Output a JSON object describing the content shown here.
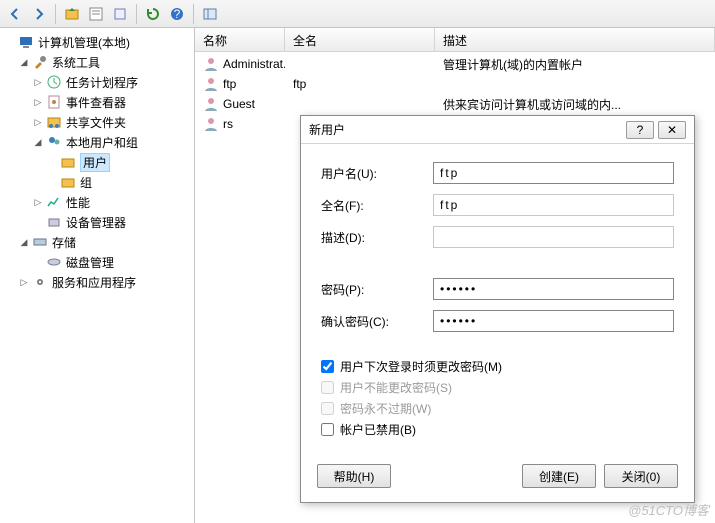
{
  "toolbar": {
    "buttons": [
      "back",
      "forward",
      "up",
      "show-hide",
      "export",
      "refresh",
      "help",
      "panel"
    ]
  },
  "tree": {
    "root": {
      "label": "计算机管理(本地)"
    },
    "sys_tools": {
      "label": "系统工具"
    },
    "task_sched": {
      "label": "任务计划程序"
    },
    "event_viewer": {
      "label": "事件查看器"
    },
    "shared_folders": {
      "label": "共享文件夹"
    },
    "local_users": {
      "label": "本地用户和组"
    },
    "users": {
      "label": "用户"
    },
    "groups": {
      "label": "组"
    },
    "perf": {
      "label": "性能"
    },
    "dev_mgr": {
      "label": "设备管理器"
    },
    "storage": {
      "label": "存储"
    },
    "disk_mgmt": {
      "label": "磁盘管理"
    },
    "services": {
      "label": "服务和应用程序"
    }
  },
  "columns": {
    "name": "名称",
    "fullname": "全名",
    "desc": "描述"
  },
  "col_widths": {
    "name": 90,
    "fullname": 150,
    "desc": 250
  },
  "rows": [
    {
      "name": "Administrat...",
      "fullname": "",
      "desc": "管理计算机(域)的内置帐户"
    },
    {
      "name": "ftp",
      "fullname": "ftp",
      "desc": ""
    },
    {
      "name": "Guest",
      "fullname": "",
      "desc": "供来宾访问计算机或访问域的内..."
    },
    {
      "name": "rs",
      "fullname": "",
      "desc": ""
    }
  ],
  "dialog": {
    "title": "新用户",
    "help_label": "?",
    "close_label": "✕",
    "fields": {
      "username_label": "用户名(U):",
      "username_value": "ftp",
      "fullname_label": "全名(F):",
      "fullname_value": "ftp",
      "desc_label": "描述(D):",
      "desc_value": "",
      "pwd_label": "密码(P):",
      "pwd2_label": "确认密码(C):"
    },
    "chk": {
      "must_change": "用户下次登录时须更改密码(M)",
      "cannot_change": "用户不能更改密码(S)",
      "never_expire": "密码永不过期(W)",
      "disabled": "帐户已禁用(B)"
    },
    "buttons": {
      "help": "帮助(H)",
      "create": "创建(E)",
      "close": "关闭(0)"
    }
  },
  "watermark": "@51CTO博客"
}
